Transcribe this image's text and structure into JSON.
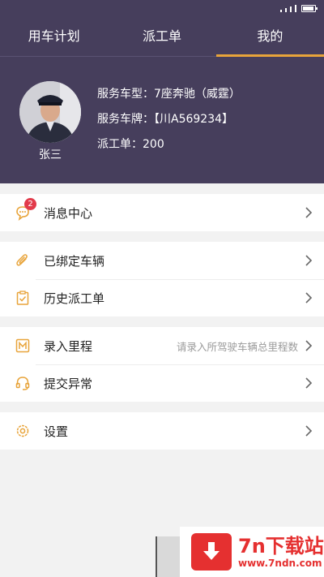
{
  "tabs": [
    {
      "label": "用车计划",
      "active": false
    },
    {
      "label": "派工单",
      "active": false
    },
    {
      "label": "我的",
      "active": true
    }
  ],
  "profile": {
    "name": "张三",
    "vehicle_type": "服务车型：7座奔驰（威霆）",
    "plate": "服务车牌：【川A569234】",
    "dispatch": "派工单：200"
  },
  "menu": {
    "messages": {
      "label": "消息中心",
      "badge": "2"
    },
    "bound_vehicles": {
      "label": "已绑定车辆"
    },
    "history": {
      "label": "历史派工单"
    },
    "mileage": {
      "label": "录入里程",
      "hint": "请录入所驾驶车辆总里程数"
    },
    "report": {
      "label": "提交异常"
    },
    "settings": {
      "label": "设置"
    }
  },
  "watermark": {
    "title": "7n下载站",
    "url": "www.7ndn.com"
  },
  "colors": {
    "header": "#463e5c",
    "accent": "#e8a43a",
    "badge": "#e23b4b"
  }
}
